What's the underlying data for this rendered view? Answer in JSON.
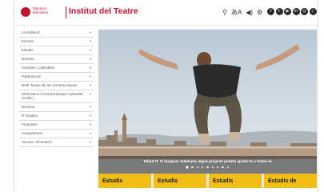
{
  "header": {
    "logo_text_line1": "Diputació",
    "logo_text_line2": "Barcelona",
    "brand": "Institut del Teatre",
    "tools": [
      {
        "icon": "search-icon",
        "glyph": "⚲"
      },
      {
        "icon": "accessibility-icon",
        "glyph": "あA"
      },
      {
        "icon": "audio-icon",
        "glyph": "◀)"
      },
      {
        "icon": "settings-icon",
        "glyph": "⚙"
      }
    ],
    "socials": [
      "f",
      "t",
      "▶",
      "in",
      "◎",
      "♪",
      "◉"
    ]
  },
  "sidebar": {
    "items": [
      {
        "label": "La Institució",
        "chevron": "▾"
      },
      {
        "label": "Escoles",
        "chevron": "▾"
      },
      {
        "label": "Estudis",
        "chevron": "▾"
      },
      {
        "label": "Notícies",
        "chevron": "▾"
      },
      {
        "label": "Activitats i Calendaris",
        "chevron": "▾"
      },
      {
        "label": "Publicacions",
        "chevron": "▾"
      },
      {
        "label": "MAE. Museu de les Arts Escèniques",
        "chevron": "▾"
      },
      {
        "label": "Observatori d'Arts Escèniques Aplicades (OAEA)",
        "chevron": "▾"
      },
      {
        "label": "Recerca",
        "chevron": "▾"
      },
      {
        "label": "IT impulsa",
        "chevron": "▾"
      },
      {
        "label": "Propostes",
        "chevron": "▾"
      },
      {
        "label": "Competicions",
        "chevron": "▾"
      },
      {
        "label": "Serveis i Informació",
        "chevron": "▾"
      }
    ]
  },
  "hero": {
    "caption": "Talent IT. Si busques talent per algun projecte podem ajudar-te a trobar-lo",
    "slide_count": 9,
    "active_slide": 0,
    "colors": {
      "accent": "#c8102e",
      "card": "#f2bd14"
    }
  },
  "cards": [
    "Estudis",
    "Estudis",
    "Estudis",
    "Estudis de"
  ]
}
